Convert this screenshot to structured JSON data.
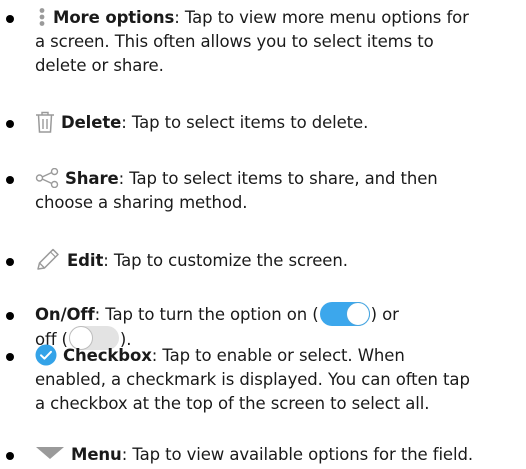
{
  "colors": {
    "accent_blue": "#3ca7ec",
    "checkbox_blue": "#34a3e8",
    "icon_gray": "#9a9a9a",
    "toggle_off": "#e3e3e3"
  },
  "items": [
    {
      "icon": "more-options-icon",
      "term": "More options",
      "line1": ": Tap to view more menu options for",
      "line2": "a screen. This often allows you to select items to",
      "line3": "delete or share."
    },
    {
      "icon": "trash-icon",
      "term": "Delete",
      "line1": ": Tap to select items to delete."
    },
    {
      "icon": "share-icon",
      "term": "Share",
      "line1": ": Tap to select items to share, and then",
      "line2": "choose a sharing method."
    },
    {
      "icon": "pencil-icon",
      "term": "Edit",
      "line1": ": Tap to customize the screen."
    },
    {
      "term": "On/Off",
      "line1": ": Tap to turn the option on (",
      "line1_end": ") or",
      "line2_start": "off (",
      "line2_end": ")."
    },
    {
      "icon": "checkbox-icon",
      "term": "Checkbox",
      "line1": ": Tap to enable or select. When",
      "line2": "enabled, a checkmark is displayed. You can often tap",
      "line3": "a checkbox at the top of the screen to select all."
    },
    {
      "icon": "dropdown-triangle-icon",
      "term": "Menu",
      "line1": ": Tap to view available options for the field."
    }
  ]
}
